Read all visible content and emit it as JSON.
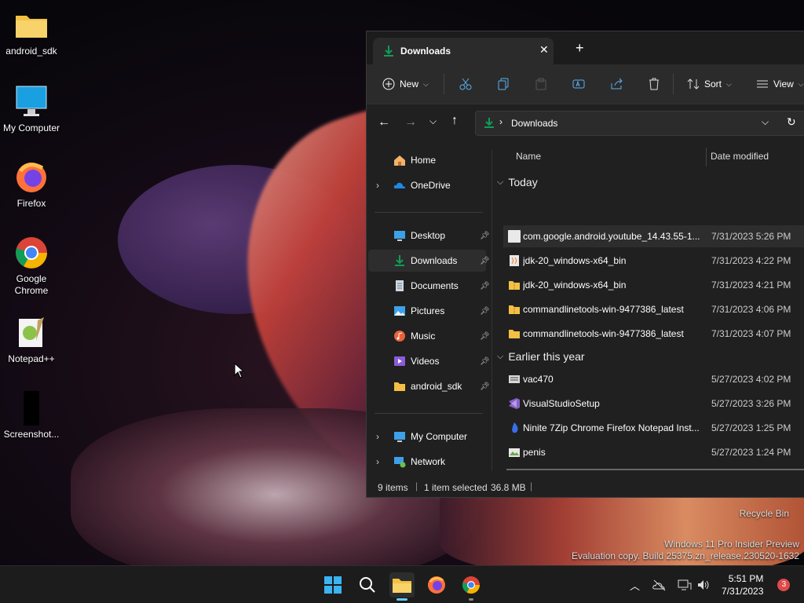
{
  "desktop": {
    "icons": [
      {
        "label": "android_sdk",
        "icon": "folder-icon"
      },
      {
        "label": "My Computer",
        "icon": "monitor-icon"
      },
      {
        "label": "Firefox",
        "icon": "firefox-icon"
      },
      {
        "label": "Google Chrome",
        "icon": "chrome-icon"
      },
      {
        "label": "Notepad++",
        "icon": "notepadpp-icon"
      },
      {
        "label": "Screenshot...",
        "icon": "screenshot-file-icon"
      }
    ],
    "recycle_bin": "Recycle Bin",
    "watermark": {
      "line1": "Windows 11 Pro Insider Preview",
      "line2": "Evaluation copy. Build 25375.zn_release.230520-1632"
    }
  },
  "explorer": {
    "tab_title": "Downloads",
    "toolbar": {
      "new_label": "New",
      "sort_label": "Sort",
      "view_label": "View",
      "icons": [
        "cut-icon",
        "copy-icon",
        "paste-icon",
        "rename-icon",
        "share-icon",
        "delete-icon"
      ]
    },
    "address": {
      "path": "Downloads"
    },
    "nav": {
      "home": "Home",
      "onedrive": "OneDrive",
      "pinned": [
        "Desktop",
        "Downloads",
        "Documents",
        "Pictures",
        "Music",
        "Videos",
        "android_sdk"
      ],
      "my_computer": "My Computer",
      "network": "Network"
    },
    "columns": {
      "name": "Name",
      "date": "Date modified"
    },
    "groups": [
      {
        "label": "Today",
        "files": [
          {
            "name": "com.google.android.youtube_14.43.55-1...",
            "date": "7/31/2023 5:26 PM",
            "icon": "file-icon"
          },
          {
            "name": "jdk-20_windows-x64_bin",
            "date": "7/31/2023 4:22 PM",
            "icon": "installer-icon"
          },
          {
            "name": "jdk-20_windows-x64_bin",
            "date": "7/31/2023 4:21 PM",
            "icon": "zip-folder-icon"
          },
          {
            "name": "commandlinetools-win-9477386_latest",
            "date": "7/31/2023 4:06 PM",
            "icon": "zip-folder-icon"
          },
          {
            "name": "commandlinetools-win-9477386_latest",
            "date": "7/31/2023 4:07 PM",
            "icon": "folder-icon"
          }
        ]
      },
      {
        "label": "Earlier this year",
        "files": [
          {
            "name": "vac470",
            "date": "5/27/2023 4:02 PM",
            "icon": "app-icon"
          },
          {
            "name": "VisualStudioSetup",
            "date": "5/27/2023 3:26 PM",
            "icon": "visual-studio-icon"
          },
          {
            "name": "Ninite 7Zip Chrome Firefox Notepad Inst...",
            "date": "5/27/2023 1:25 PM",
            "icon": "ninite-icon"
          },
          {
            "name": "penis",
            "date": "5/27/2023 1:24 PM",
            "icon": "image-icon"
          }
        ]
      }
    ],
    "status": {
      "count": "9 items",
      "selection": "1 item selected",
      "size": "36.8 MB"
    }
  },
  "taskbar": {
    "time": "5:51 PM",
    "date": "7/31/2023",
    "notification_count": "3",
    "apps": [
      "start-icon",
      "search-icon",
      "file-explorer-icon",
      "firefox-icon",
      "chrome-icon"
    ]
  },
  "colors": {
    "accent": "#0f9d58",
    "selected_row": "#2d2d2d",
    "window_bg": "#202020"
  }
}
